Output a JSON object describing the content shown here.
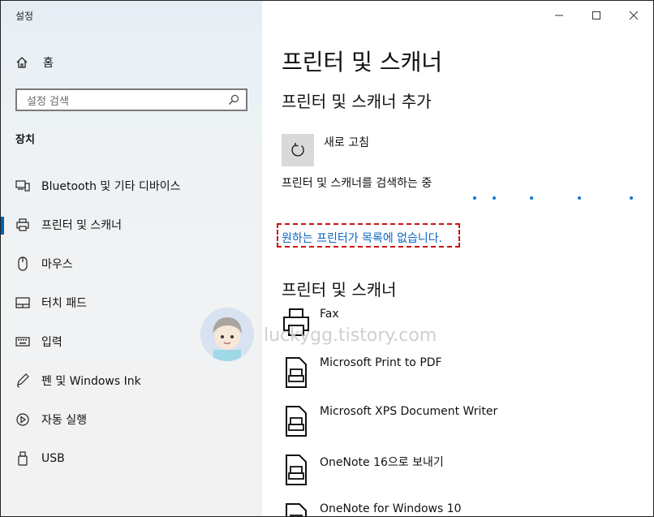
{
  "window": {
    "title": "설정"
  },
  "sidebar": {
    "home": "홈",
    "search_placeholder": "설정 검색",
    "section": "장치",
    "items": [
      {
        "label": "Bluetooth 및 기타 디바이스",
        "icon": "bluetooth-devices-icon"
      },
      {
        "label": "프린터 및 스캐너",
        "icon": "printer-icon",
        "active": true
      },
      {
        "label": "마우스",
        "icon": "mouse-icon"
      },
      {
        "label": "터치 패드",
        "icon": "touchpad-icon"
      },
      {
        "label": "입력",
        "icon": "keyboard-icon"
      },
      {
        "label": "펜 및 Windows Ink",
        "icon": "pen-icon"
      },
      {
        "label": "자동 실행",
        "icon": "autoplay-icon"
      },
      {
        "label": "USB",
        "icon": "usb-icon"
      }
    ]
  },
  "main": {
    "title": "프린터 및 스캐너",
    "add_title": "프린터 및 스캐너 추가",
    "refresh_label": "새로 고침",
    "searching_text": "프린터 및 스캐너를 검색하는 중",
    "not_listed_link": "원하는 프린터가 목록에 없습니다.",
    "list_title": "프린터 및 스캐너",
    "printers": [
      "Fax",
      "Microsoft Print to PDF",
      "Microsoft XPS Document Writer",
      "OneNote 16으로 보내기",
      "OneNote for Windows 10"
    ]
  },
  "watermark": {
    "text": "luckygg.tistory.com"
  },
  "colors": {
    "accent": "#0063b1",
    "link": "#0a66c2",
    "highlight_border": "#cc1111",
    "progress_dots": "#0a78d4"
  }
}
